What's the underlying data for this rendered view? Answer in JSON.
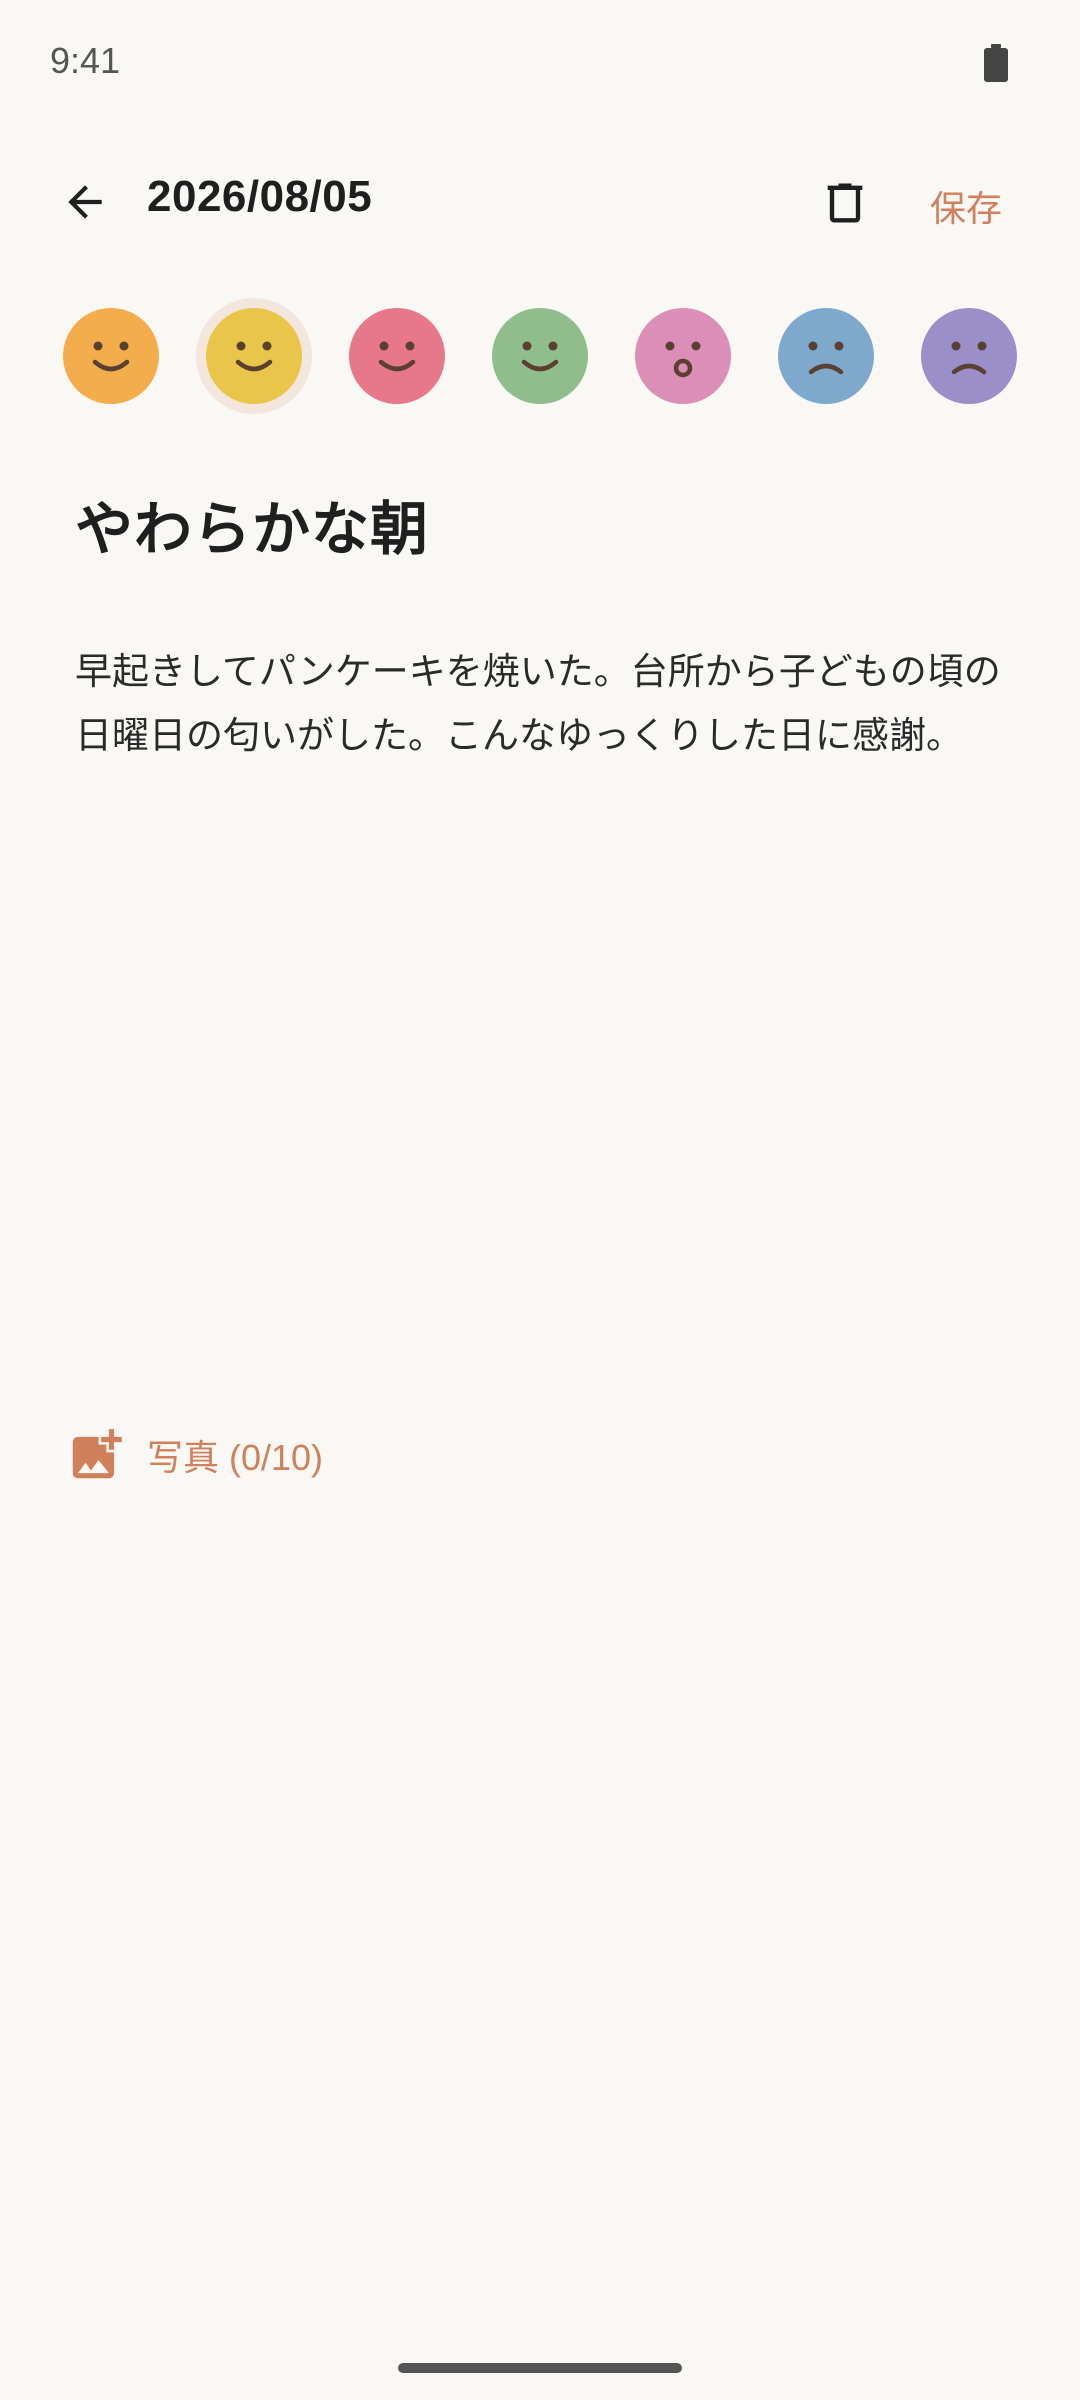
{
  "status_bar": {
    "time": "9:41",
    "battery_icon": "battery-full-icon"
  },
  "header": {
    "back_icon": "arrow-left-icon",
    "date": "2026/08/05",
    "delete_icon": "trash-icon",
    "save_label": "保存"
  },
  "moods": [
    {
      "name": "happy-orange",
      "color": "#f3ad4c",
      "expression": "smile",
      "selected": false
    },
    {
      "name": "happy-yellow",
      "color": "#e9c64a",
      "expression": "smile",
      "selected": true
    },
    {
      "name": "happy-pink-red",
      "color": "#e6788a",
      "expression": "smile",
      "selected": false
    },
    {
      "name": "happy-green",
      "color": "#90bd8c",
      "expression": "smile",
      "selected": false
    },
    {
      "name": "surprised-pink",
      "color": "#dc8fb6",
      "expression": "surprised",
      "selected": false
    },
    {
      "name": "sad-blue",
      "color": "#7fa9cc",
      "expression": "frown",
      "selected": false
    },
    {
      "name": "sad-purple",
      "color": "#9b8fca",
      "expression": "frown",
      "selected": false
    }
  ],
  "entry": {
    "title": "やわらかな朝",
    "body": "早起きしてパンケーキを焼いた。台所から子どもの頃の日曜日の匂いがした。こんなゆっくりした日に感謝。"
  },
  "photos": {
    "icon": "add-photo-icon",
    "label": "写真 (0/10)"
  },
  "colors": {
    "accent": "#d0805a",
    "background": "#faf8f5"
  }
}
